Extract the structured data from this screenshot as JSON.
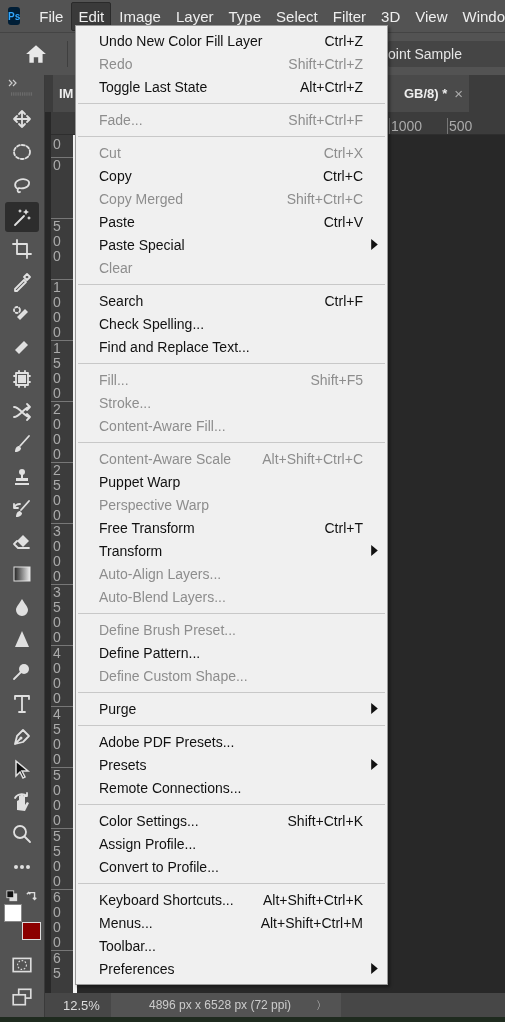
{
  "app_logo": "Ps",
  "menu_bar": {
    "items": [
      {
        "label": "File",
        "selected": false
      },
      {
        "label": "Edit",
        "selected": true
      },
      {
        "label": "Image",
        "selected": false
      },
      {
        "label": "Layer",
        "selected": false
      },
      {
        "label": "Type",
        "selected": false
      },
      {
        "label": "Select",
        "selected": false
      },
      {
        "label": "Filter",
        "selected": false
      },
      {
        "label": "3D",
        "selected": false
      },
      {
        "label": "View",
        "selected": false
      },
      {
        "label": "Windo",
        "selected": false
      }
    ]
  },
  "options_bar": {
    "sample_field": "oint Sample"
  },
  "tools": [
    {
      "selected": false
    },
    {
      "selected": false
    },
    {
      "selected": false
    },
    {
      "selected": true
    },
    {
      "selected": false
    },
    {
      "selected": false
    },
    {
      "selected": false
    },
    {
      "selected": false
    },
    {
      "selected": false
    },
    {
      "selected": false
    },
    {
      "selected": false
    },
    {
      "selected": false
    },
    {
      "selected": false
    },
    {
      "selected": false
    },
    {
      "selected": false
    },
    {
      "selected": false
    },
    {
      "selected": false
    },
    {
      "selected": false
    },
    {
      "selected": false
    },
    {
      "selected": false
    },
    {
      "selected": false
    },
    {
      "selected": false
    },
    {
      "selected": false
    },
    {
      "selected": false
    }
  ],
  "document_tab": {
    "title_start": "IM",
    "title_end": "GB/8) *",
    "close": "×"
  },
  "horizontal_ruler": [
    "1000",
    "500"
  ],
  "vertical_ruler": [
    "0",
    "0",
    "500",
    "1000",
    "1500",
    "2000",
    "2500",
    "3000",
    "3500",
    "4000",
    "4500",
    "5000",
    "5500",
    "6000",
    "65"
  ],
  "edit_menu": [
    [
      {
        "label": "Undo New Color Fill Layer",
        "shortcut": "Ctrl+Z",
        "disabled": false,
        "submenu": false
      },
      {
        "label": "Redo",
        "shortcut": "Shift+Ctrl+Z",
        "disabled": true,
        "submenu": false
      },
      {
        "label": "Toggle Last State",
        "shortcut": "Alt+Ctrl+Z",
        "disabled": false,
        "submenu": false
      }
    ],
    [
      {
        "label": "Fade...",
        "shortcut": "Shift+Ctrl+F",
        "disabled": true,
        "submenu": false
      }
    ],
    [
      {
        "label": "Cut",
        "shortcut": "Ctrl+X",
        "disabled": true,
        "submenu": false
      },
      {
        "label": "Copy",
        "shortcut": "Ctrl+C",
        "disabled": false,
        "submenu": false
      },
      {
        "label": "Copy Merged",
        "shortcut": "Shift+Ctrl+C",
        "disabled": true,
        "submenu": false
      },
      {
        "label": "Paste",
        "shortcut": "Ctrl+V",
        "disabled": false,
        "submenu": false
      },
      {
        "label": "Paste Special",
        "disabled": false,
        "submenu": true
      },
      {
        "label": "Clear",
        "disabled": true,
        "submenu": false
      }
    ],
    [
      {
        "label": "Search",
        "shortcut": "Ctrl+F",
        "disabled": false,
        "submenu": false
      },
      {
        "label": "Check Spelling...",
        "disabled": false,
        "submenu": false
      },
      {
        "label": "Find and Replace Text...",
        "disabled": false,
        "submenu": false
      }
    ],
    [
      {
        "label": "Fill...",
        "shortcut": "Shift+F5",
        "disabled": true,
        "submenu": false
      },
      {
        "label": "Stroke...",
        "disabled": true,
        "submenu": false
      },
      {
        "label": "Content-Aware Fill...",
        "disabled": true,
        "submenu": false
      }
    ],
    [
      {
        "label": "Content-Aware Scale",
        "shortcut": "Alt+Shift+Ctrl+C",
        "disabled": true,
        "submenu": false
      },
      {
        "label": "Puppet Warp",
        "disabled": false,
        "submenu": false
      },
      {
        "label": "Perspective Warp",
        "disabled": true,
        "submenu": false
      },
      {
        "label": "Free Transform",
        "shortcut": "Ctrl+T",
        "disabled": false,
        "submenu": false
      },
      {
        "label": "Transform",
        "disabled": false,
        "submenu": true
      },
      {
        "label": "Auto-Align Layers...",
        "disabled": true,
        "submenu": false
      },
      {
        "label": "Auto-Blend Layers...",
        "disabled": true,
        "submenu": false
      }
    ],
    [
      {
        "label": "Define Brush Preset...",
        "disabled": true,
        "submenu": false
      },
      {
        "label": "Define Pattern...",
        "disabled": false,
        "submenu": false
      },
      {
        "label": "Define Custom Shape...",
        "disabled": true,
        "submenu": false
      }
    ],
    [
      {
        "label": "Purge",
        "disabled": false,
        "submenu": true
      }
    ],
    [
      {
        "label": "Adobe PDF Presets...",
        "disabled": false,
        "submenu": false
      },
      {
        "label": "Presets",
        "disabled": false,
        "submenu": true
      },
      {
        "label": "Remote Connections...",
        "disabled": false,
        "submenu": false
      }
    ],
    [
      {
        "label": "Color Settings...",
        "shortcut": "Shift+Ctrl+K",
        "disabled": false,
        "submenu": false
      },
      {
        "label": "Assign Profile...",
        "disabled": false,
        "submenu": false
      },
      {
        "label": "Convert to Profile...",
        "disabled": false,
        "submenu": false
      }
    ],
    [
      {
        "label": "Keyboard Shortcuts...",
        "shortcut": "Alt+Shift+Ctrl+K",
        "disabled": false,
        "submenu": false
      },
      {
        "label": "Menus...",
        "shortcut": "Alt+Shift+Ctrl+M",
        "disabled": false,
        "submenu": false
      },
      {
        "label": "Toolbar...",
        "disabled": false,
        "submenu": false
      },
      {
        "label": "Preferences",
        "disabled": false,
        "submenu": true
      }
    ]
  ],
  "status_bar": {
    "zoom": "12.5%",
    "document_info": "4896 px x 6528 px (72 ppi)",
    "expand": "〉"
  }
}
